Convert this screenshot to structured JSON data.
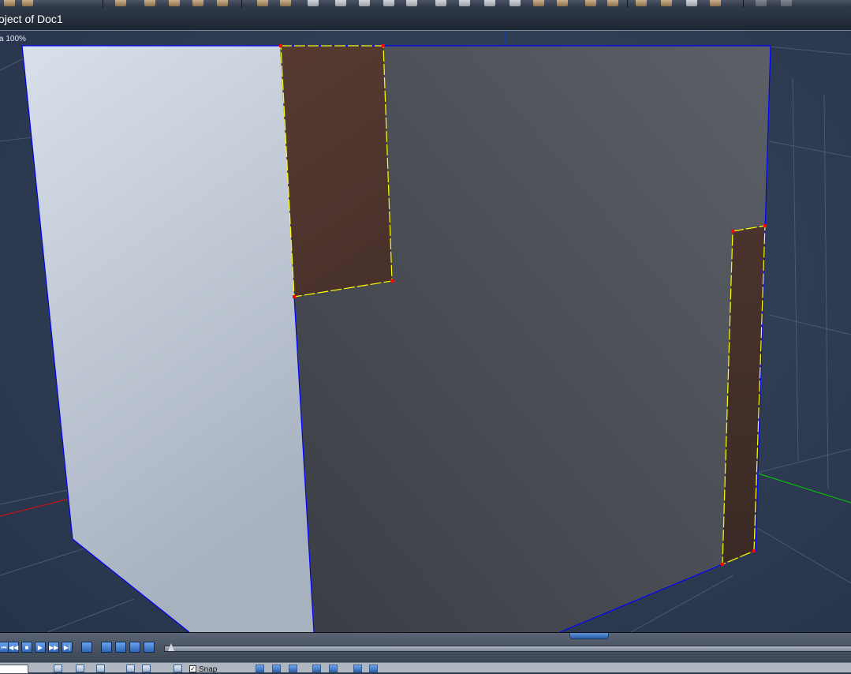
{
  "window": {
    "title": "oject of Doc1"
  },
  "viewport": {
    "zoom_label": "a 100%"
  },
  "bottom_toolbar": {
    "snap_label": "Snap",
    "snap_checked": "✓"
  },
  "timeline": {
    "buttons": [
      {
        "name": "go-start",
        "icon": "⏮"
      },
      {
        "name": "step-back",
        "icon": "◀◀"
      },
      {
        "name": "stop",
        "icon": "■"
      },
      {
        "name": "play",
        "icon": "▶"
      },
      {
        "name": "step-forward",
        "icon": "▶▶"
      },
      {
        "name": "go-end",
        "icon": "▶|"
      }
    ]
  },
  "colors": {
    "background": "#2b3a4f",
    "face_light": "#d4dde8",
    "face_dark": "#464b52",
    "selected_face": "#4f342c",
    "edge": "#0000ff",
    "selected_edge": "#ffff00",
    "vertex": "#ff0000",
    "axis_red": "#e01010",
    "axis_green": "#00d000"
  }
}
